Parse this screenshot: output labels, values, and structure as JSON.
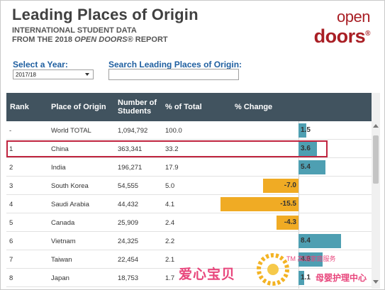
{
  "header": {
    "title": "Leading Places of Origin",
    "subtitle_line1": "INTERNATIONAL STUDENT DATA",
    "subtitle_line2_prefix": "FROM THE 2018 ",
    "subtitle_line2_em": "OPEN DOORS",
    "subtitle_line2_suffix": "® REPORT"
  },
  "logo": {
    "line1": "open",
    "line2": "doors",
    "mark": "®"
  },
  "filters": {
    "year_label": "Select a Year:",
    "year_value": "2017/18",
    "search_label": "Search Leading Places of Origin:",
    "search_value": ""
  },
  "table": {
    "columns": [
      "Rank",
      "Place of Origin",
      "Number of\nStudents",
      "% of Total",
      "% Change"
    ],
    "rows": [
      {
        "rank": "-",
        "place": "World TOTAL",
        "students": "1,094,792",
        "pct_total": "100.0",
        "change": 1.5,
        "change_label": "1.5"
      },
      {
        "rank": "1",
        "place": "China",
        "students": "363,341",
        "pct_total": "33.2",
        "change": 3.6,
        "change_label": "3.6"
      },
      {
        "rank": "2",
        "place": "India",
        "students": "196,271",
        "pct_total": "17.9",
        "change": 5.4,
        "change_label": "5.4"
      },
      {
        "rank": "3",
        "place": "South Korea",
        "students": "54,555",
        "pct_total": "5.0",
        "change": -7.0,
        "change_label": "-7.0"
      },
      {
        "rank": "4",
        "place": "Saudi Arabia",
        "students": "44,432",
        "pct_total": "4.1",
        "change": -15.5,
        "change_label": "-15.5"
      },
      {
        "rank": "5",
        "place": "Canada",
        "students": "25,909",
        "pct_total": "2.4",
        "change": -4.3,
        "change_label": "-4.3"
      },
      {
        "rank": "6",
        "place": "Vietnam",
        "students": "24,325",
        "pct_total": "2.2",
        "change": 8.4,
        "change_label": "8.4"
      },
      {
        "rank": "7",
        "place": "Taiwan",
        "students": "22,454",
        "pct_total": "2.1",
        "change": 4.8,
        "change_label": "4.8"
      },
      {
        "rank": "8",
        "place": "Japan",
        "students": "18,753",
        "pct_total": "1.7",
        "change": 1.1,
        "change_label": "1.1"
      }
    ]
  },
  "colors": {
    "header_bg": "#41535f",
    "positive_bar": "#4e9fb2",
    "negative_bar": "#f0ab24",
    "highlight": "#c0243f",
    "label_blue": "#1f5fa0",
    "brand_red": "#a91f25"
  },
  "watermark": {
    "left_text": "爱心宝贝",
    "tm_text": "TM 高端家庭服务",
    "right_text": "母婴护理中心"
  }
}
